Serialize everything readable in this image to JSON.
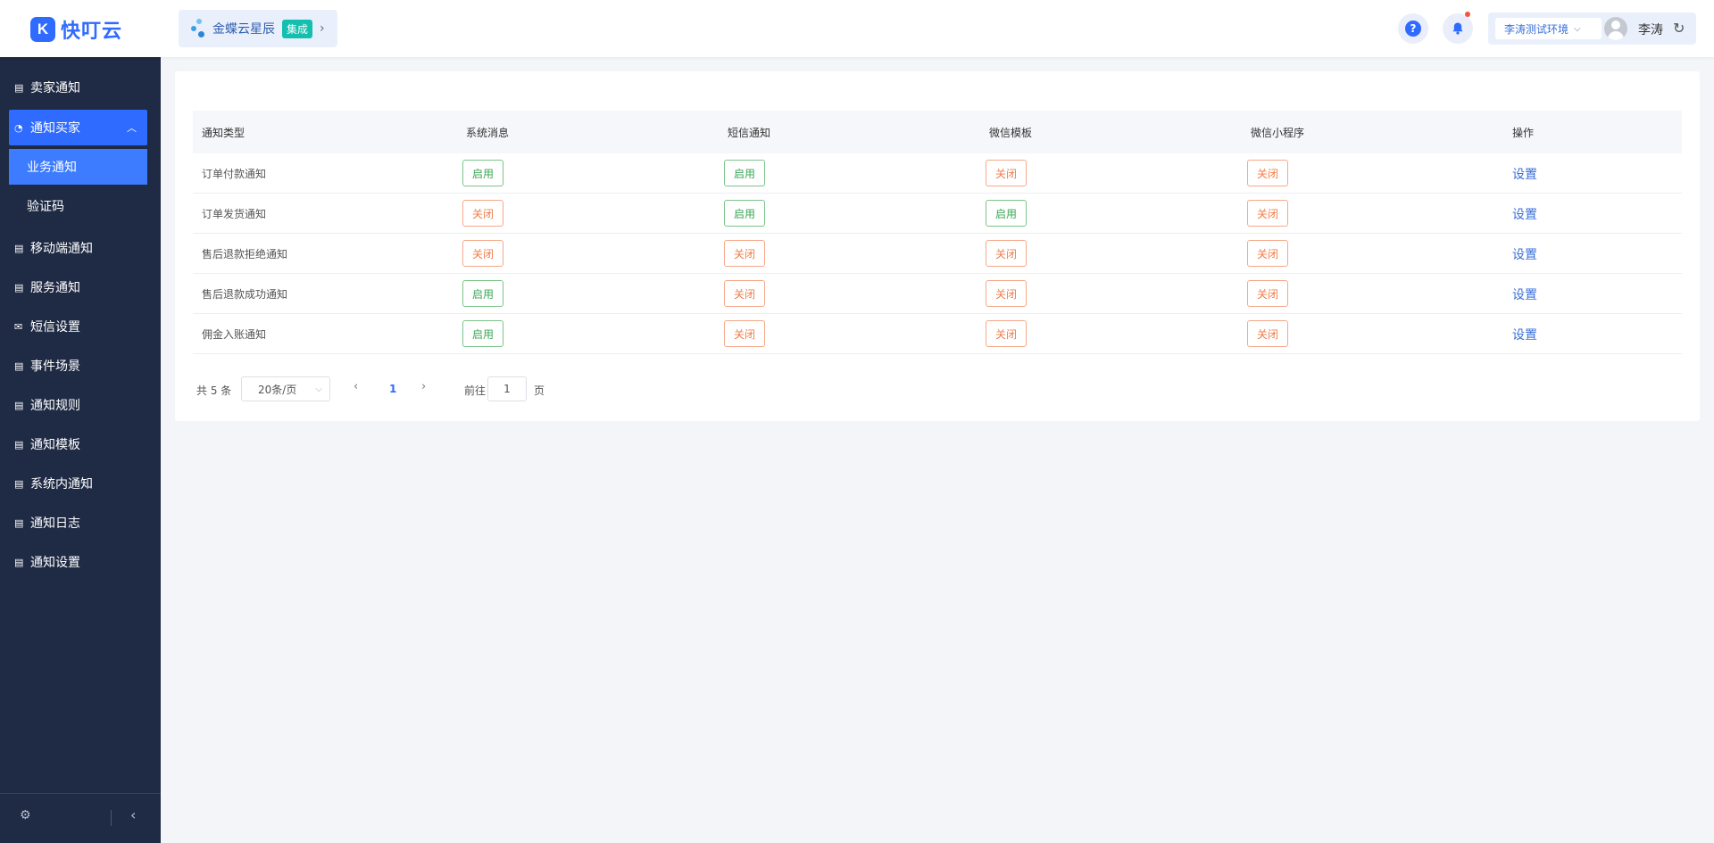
{
  "header": {
    "logo_text": "快叮云",
    "logo_mark": "K",
    "product_name": "金蝶云星辰",
    "product_badge": "集成",
    "help_glyph": "?",
    "env_select": "李涛测试环境",
    "user_name": "李涛"
  },
  "sidebar": {
    "menu": [
      {
        "label": "卖家通知",
        "icon": "list-icon"
      },
      {
        "label": "通知买家",
        "icon": "chat-icon",
        "open": true
      },
      {
        "label": "移动端通知",
        "icon": "list-icon"
      },
      {
        "label": "服务通知",
        "icon": "list-icon"
      },
      {
        "label": "短信设置",
        "icon": "mail-icon"
      },
      {
        "label": "事件场景",
        "icon": "list-icon"
      },
      {
        "label": "通知规则",
        "icon": "list-icon"
      },
      {
        "label": "通知模板",
        "icon": "list-icon"
      },
      {
        "label": "系统内通知",
        "icon": "list-icon"
      },
      {
        "label": "通知日志",
        "icon": "list-icon"
      },
      {
        "label": "通知设置",
        "icon": "list-icon"
      }
    ],
    "submenu": [
      {
        "label": "业务通知",
        "active": true
      },
      {
        "label": "验证码",
        "active": false
      }
    ]
  },
  "table": {
    "columns": [
      "通知类型",
      "系统消息",
      "短信通知",
      "微信模板",
      "微信小程序",
      "操作"
    ],
    "rows": [
      {
        "type": "订单付款通知",
        "system": "启用",
        "sms": "启用",
        "wechat_tpl": "关闭",
        "wechat_mini": "关闭",
        "action": "设置"
      },
      {
        "type": "订单发货通知",
        "system": "关闭",
        "sms": "启用",
        "wechat_tpl": "启用",
        "wechat_mini": "关闭",
        "action": "设置"
      },
      {
        "type": "售后退款拒绝通知",
        "system": "关闭",
        "sms": "关闭",
        "wechat_tpl": "关闭",
        "wechat_mini": "关闭",
        "action": "设置"
      },
      {
        "type": "售后退款成功通知",
        "system": "启用",
        "sms": "关闭",
        "wechat_tpl": "关闭",
        "wechat_mini": "关闭",
        "action": "设置"
      },
      {
        "type": "佣金入账通知",
        "system": "启用",
        "sms": "关闭",
        "wechat_tpl": "关闭",
        "wechat_mini": "关闭",
        "action": "设置"
      }
    ]
  },
  "pagination": {
    "total_text": "共 5 条",
    "page_size": "20条/页",
    "current_page": "1",
    "goto_label": "前往",
    "goto_value": "1",
    "page_suffix": "页"
  },
  "colors": {
    "brand": "#2f6bff",
    "sidebar_bg": "#1f2b44",
    "enabled": "#3aa655",
    "disabled": "#f07d4a"
  }
}
